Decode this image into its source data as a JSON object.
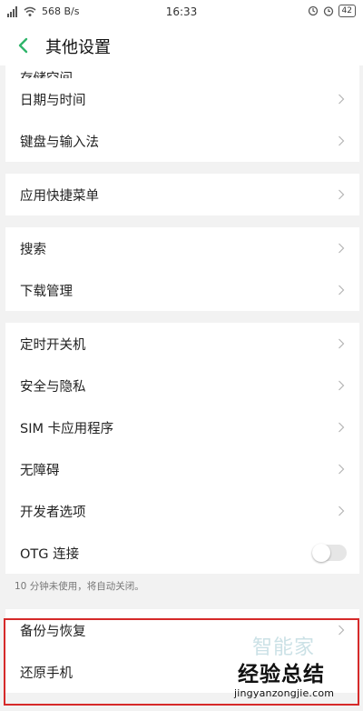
{
  "status_bar": {
    "speed": "568 B/s",
    "time": "16:33",
    "battery": "42"
  },
  "header": {
    "title": "其他设置"
  },
  "sections": {
    "partial_item": "存储空间",
    "date_time": "日期与时间",
    "keyboard": "键盘与输入法",
    "app_shortcut": "应用快捷菜单",
    "search": "搜索",
    "download": "下载管理",
    "schedule_power": "定时开关机",
    "security": "安全与隐私",
    "sim_apps": "SIM 卡应用程序",
    "accessibility": "无障碍",
    "developer": "开发者选项",
    "otg": "OTG 连接",
    "otg_note": "10 分钟未使用，将自动关闭。",
    "backup": "备份与恢复",
    "reset": "还原手机"
  },
  "otg_enabled": false,
  "watermark": {
    "faint": "智能家",
    "main": "经验总结",
    "url": "jingyanzongjie.com"
  },
  "colors": {
    "highlight": "#d62a2a",
    "back_arrow": "#2fb56a"
  }
}
